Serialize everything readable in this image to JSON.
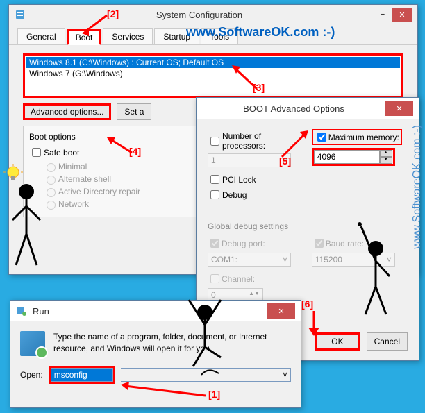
{
  "sysconfig": {
    "title": "System Configuration",
    "tabs": [
      "General",
      "Boot",
      "Services",
      "Startup",
      "Tools"
    ],
    "bootlist": [
      {
        "text": "Windows 8.1 (C:\\Windows) : Current OS; Default OS",
        "selected": true
      },
      {
        "text": "Windows 7 (G:\\Windows)",
        "selected": false
      }
    ],
    "adv_button": "Advanced options...",
    "set_default": "Set a",
    "boot_options_title": "Boot options",
    "safe_boot": "Safe boot",
    "minimal": "Minimal",
    "alt_shell": "Alternate shell",
    "ad_repair": "Active Directory repair",
    "network": "Network"
  },
  "advopts": {
    "title": "BOOT Advanced Options",
    "num_proc": "Number of processors:",
    "num_proc_val": "1",
    "max_mem": "Maximum memory:",
    "max_mem_val": "4096",
    "pci_lock": "PCI Lock",
    "debug": "Debug",
    "global_title": "Global debug settings",
    "debug_port": "Debug port:",
    "debug_port_val": "COM1:",
    "baud_rate": "Baud rate:",
    "baud_rate_val": "115200",
    "channel": "Channel:",
    "channel_val": "0",
    "ok": "OK",
    "cancel": "Cancel"
  },
  "run": {
    "title": "Run",
    "text": "Type the name of a program, folder, document, or Internet resource, and Windows will open it for you.",
    "open_label": "Open:",
    "open_value": "msconfig"
  },
  "annotations": {
    "a1": "[1]",
    "a2": "[2]",
    "a3": "[3]",
    "a4": "[4]",
    "a5": "[5]",
    "a6": "[6]"
  },
  "watermark": "www.SoftwareOK.com :-)",
  "watermark2": "www.SoftwareOK.com :-)"
}
